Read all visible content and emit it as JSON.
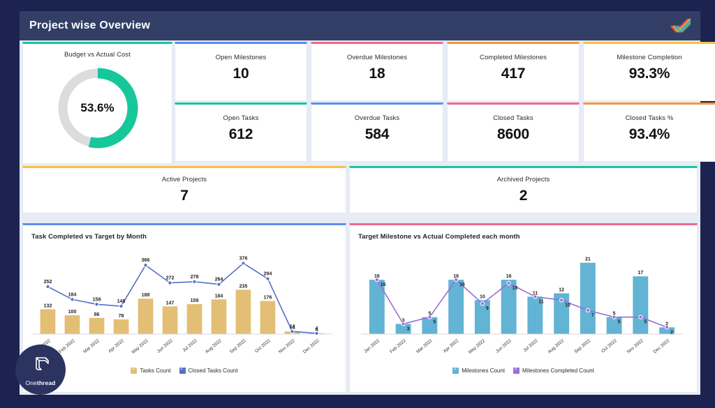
{
  "header": {
    "title": "Project wise Overview",
    "logo_icon": "checkmark-swoosh-logo"
  },
  "colors": {
    "teal": "#16c79a",
    "blue": "#5b8def",
    "pink": "#ef6a8b",
    "orange": "#f5973d",
    "yellow": "#f9c23c",
    "bar_gold": "#e3be75",
    "line_blue": "#5470c6",
    "bar_cyan": "#62b3d4",
    "line_purple": "#9b6dd6",
    "header_bg": "#333e66",
    "page_bg": "#1d2350"
  },
  "donut": {
    "title": "Budget vs Actual Cost",
    "value_label": "53.6%",
    "percent": 53.6,
    "accent": "#16c79a",
    "track": "#dcdcdc"
  },
  "kpis": [
    {
      "title": "Open Milestones",
      "value": "10",
      "accent": "#5b8def"
    },
    {
      "title": "Overdue Milestones",
      "value": "18",
      "accent": "#ef6a8b"
    },
    {
      "title": "Completed Milestones",
      "value": "417",
      "accent": "#f5973d"
    },
    {
      "title": "Milestone Completion",
      "value": "93.3%",
      "accent": "#f9c23c"
    },
    {
      "title": "Open Tasks",
      "value": "612",
      "accent": "#16c79a"
    },
    {
      "title": "Overdue Tasks",
      "value": "584",
      "accent": "#5b8def"
    },
    {
      "title": "Closed Tasks",
      "value": "8600",
      "accent": "#ef6a8b"
    },
    {
      "title": "Closed Tasks %",
      "value": "93.4%",
      "accent": "#f5973d"
    }
  ],
  "projects": [
    {
      "title": "Active Projects",
      "value": "7",
      "accent": "#f9c23c"
    },
    {
      "title": "Archived Projects",
      "value": "2",
      "accent": "#16c79a"
    }
  ],
  "chart_data": [
    {
      "type": "bar",
      "panel_accent": "#5b8def",
      "title": "Task Completed vs Target by Month",
      "xlabel": "",
      "ylabel": "",
      "ylim": [
        0,
        400
      ],
      "grid": false,
      "legend_position": "bottom",
      "categories": [
        "Jan 2022",
        "Feb 2022",
        "Mar 2022",
        "Apr 2022",
        "May 2022",
        "Jun 2022",
        "Jul 2022",
        "Aug 2022",
        "Sep 2022",
        "Oct 2022",
        "Nov 2022",
        "Dec 2022"
      ],
      "series": [
        {
          "name": "Tasks Count",
          "chart_kind": "bar",
          "color": "#e3be75",
          "values": [
            132,
            100,
            86,
            78,
            188,
            147,
            159,
            184,
            235,
            176,
            14,
            4
          ]
        },
        {
          "name": "Closed Tasks Count",
          "chart_kind": "line",
          "color": "#5470c6",
          "values": [
            252,
            184,
            158,
            148,
            366,
            272,
            278,
            264,
            376,
            294,
            14,
            4
          ]
        }
      ]
    },
    {
      "type": "bar",
      "panel_accent": "#ef6a8b",
      "title": "Target Milestone vs Actual Completed each month",
      "xlabel": "",
      "ylabel": "",
      "ylim": [
        0,
        23
      ],
      "grid": false,
      "legend_position": "bottom",
      "categories": [
        "Jan 2022",
        "Feb 2022",
        "Mar 2022",
        "Apr 2022",
        "May 2022",
        "Jun 2022",
        "Jul 2022",
        "Aug 2022",
        "Sep 2022",
        "Oct 2022",
        "Nov 2022",
        "Dec 2022"
      ],
      "series": [
        {
          "name": "Milestones Count",
          "chart_kind": "bar",
          "color": "#62b3d4",
          "values": [
            16,
            3,
            5,
            16,
            10,
            16,
            11,
            12,
            21,
            5,
            17,
            2
          ]
        },
        {
          "name": "Milestones Completed Count",
          "chart_kind": "line",
          "color": "#9b6dd6",
          "values": [
            16,
            3,
            5,
            16,
            9,
            15,
            11,
            10,
            7,
            5,
            5,
            2
          ]
        }
      ]
    }
  ],
  "watermark": {
    "brand_prefix": "One",
    "brand_suffix": "thread",
    "icon": "onethread-cube-logo"
  }
}
